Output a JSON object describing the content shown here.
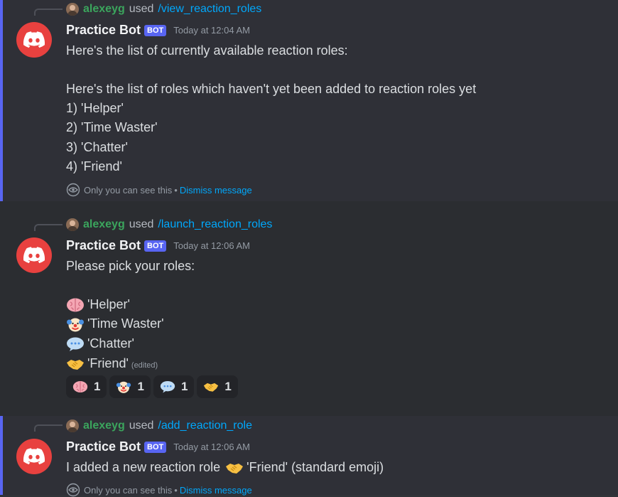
{
  "messages": [
    {
      "reply_user": "alexeyg",
      "reply_used": "used",
      "reply_command": "/view_reaction_roles",
      "author": "Practice Bot",
      "tag": "BOT",
      "time": "Today at 12:04 AM",
      "lines": [
        "Here's the list of currently available reaction roles:",
        "Here's the list of roles which haven't yet been added to reaction roles yet",
        "1) 'Helper'",
        "2) 'Time Waster'",
        "3) 'Chatter'",
        "4) 'Friend'"
      ],
      "ephemeral_note": "Only you can see this",
      "dismiss": "Dismiss message"
    },
    {
      "reply_user": "alexeyg",
      "reply_used": "used",
      "reply_command": "/launch_reaction_roles",
      "author": "Practice Bot",
      "tag": "BOT",
      "time": "Today at 12:06 AM",
      "intro": "Please pick your roles:",
      "roles": [
        {
          "emoji": "brain-emoji",
          "text": "'Helper'"
        },
        {
          "emoji": "clown-emoji",
          "text": "'Time Waster'"
        },
        {
          "emoji": "speech-balloon-emoji",
          "text": "'Chatter'"
        },
        {
          "emoji": "handshake-emoji",
          "text": "'Friend'"
        }
      ],
      "edited": "(edited)",
      "reactions": [
        {
          "emoji": "brain-emoji",
          "count": "1"
        },
        {
          "emoji": "clown-emoji",
          "count": "1"
        },
        {
          "emoji": "speech-balloon-emoji",
          "count": "1"
        },
        {
          "emoji": "handshake-emoji",
          "count": "1"
        }
      ]
    },
    {
      "reply_user": "alexeyg",
      "reply_used": "used",
      "reply_command": "/add_reaction_role",
      "author": "Practice Bot",
      "tag": "BOT",
      "time": "Today at 12:06 AM",
      "text_before": "I added a new reaction role",
      "text_after": "'Friend' (standard emoji)",
      "ephemeral_note": "Only you can see this",
      "dismiss": "Dismiss message"
    }
  ],
  "colors": {
    "background": "#313338",
    "ephemeral_accent": "#5865f2",
    "link": "#00a8fc",
    "username": "#3ba55d",
    "avatar": "#e8413f"
  }
}
